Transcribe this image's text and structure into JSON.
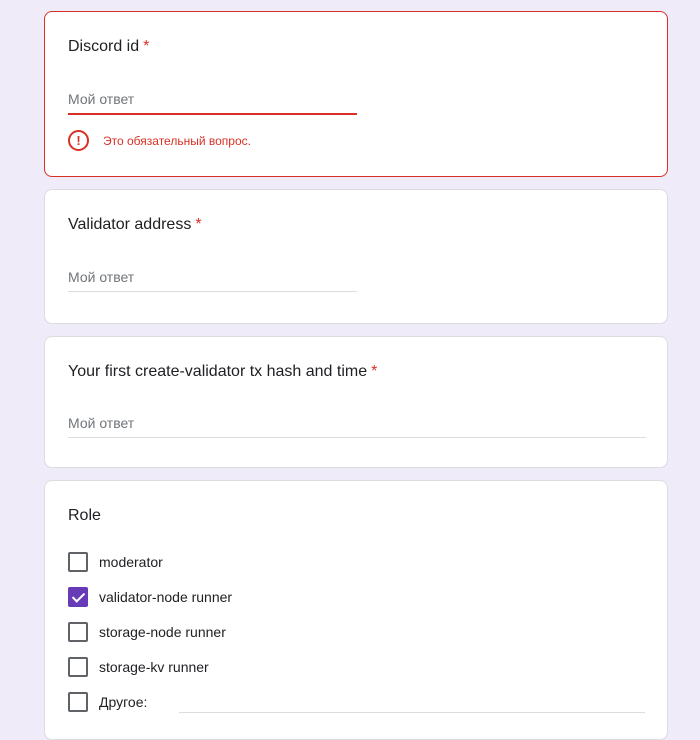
{
  "questions": {
    "discord": {
      "title": "Discord id",
      "required_mark": "*",
      "placeholder": "Мой ответ",
      "error": "Это обязательный вопрос."
    },
    "validator_address": {
      "title": "Validator address",
      "required_mark": "*",
      "placeholder": "Мой ответ"
    },
    "first_tx": {
      "title": "Your first create-validator tx hash and time",
      "required_mark": "*",
      "placeholder": "Мой ответ"
    },
    "role": {
      "title": "Role",
      "options": [
        {
          "label": "moderator",
          "checked": false
        },
        {
          "label": "validator-node runner",
          "checked": true
        },
        {
          "label": "storage-node runner",
          "checked": false
        },
        {
          "label": "storage-kv runner",
          "checked": false
        },
        {
          "label": "Другое:",
          "checked": false
        }
      ]
    }
  },
  "colors": {
    "background": "#efebf8",
    "error": "#d93025",
    "accent": "#673ab7"
  }
}
